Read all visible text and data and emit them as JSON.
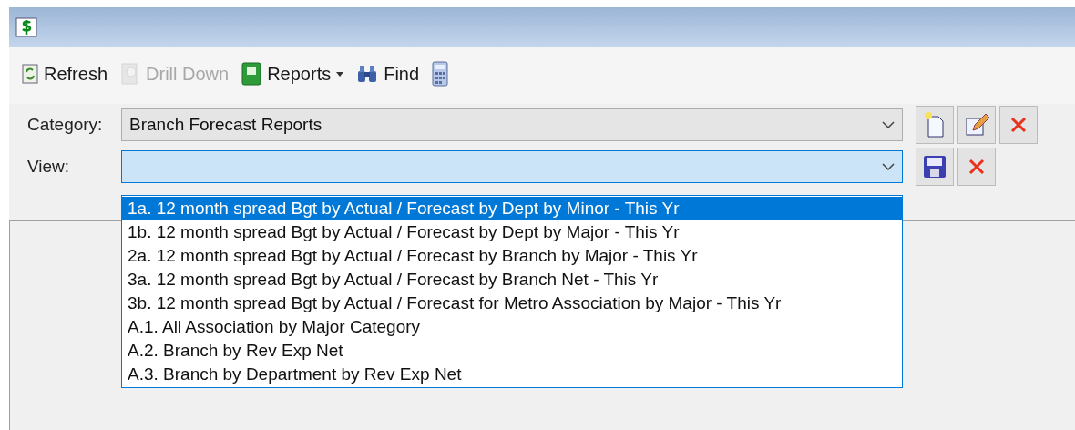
{
  "toolbar": [
    {
      "label": "Refresh",
      "kind": "refresh",
      "disabled": false
    },
    {
      "label": "Drill Down",
      "kind": "drill",
      "disabled": true
    },
    {
      "label": "Reports",
      "kind": "reports",
      "disabled": false,
      "menu": true
    },
    {
      "label": "Find",
      "kind": "find",
      "disabled": false
    },
    {
      "kind": "calculator",
      "disabled": false
    }
  ],
  "category": {
    "label": "Category:",
    "value": "Branch Forecast Reports"
  },
  "view": {
    "label": "View:",
    "expanded": true
  },
  "view_options": [
    {
      "label": "1a. 12 month spread Bgt by Actual / Forecast by Dept by Minor - This Yr",
      "selected": true
    },
    {
      "label": "1b. 12 month spread Bgt by Actual / Forecast by Dept by Major - This Yr",
      "selected": false
    },
    {
      "label": "2a. 12 month spread Bgt by Actual / Forecast by Branch by Major - This Yr",
      "selected": false
    },
    {
      "label": "3a. 12 month spread Bgt by Actual / Forecast by Branch Net - This Yr",
      "selected": false
    },
    {
      "label": "3b. 12 month spread Bgt by Actual / Forecast for Metro Association by Major - This Yr",
      "selected": false
    },
    {
      "label": "A.1. All Association by Major Category",
      "selected": false
    },
    {
      "label": "A.2. Branch by Rev Exp Net",
      "selected": false
    },
    {
      "label": "A.3. Branch by Department by Rev Exp Net",
      "selected": false
    }
  ]
}
